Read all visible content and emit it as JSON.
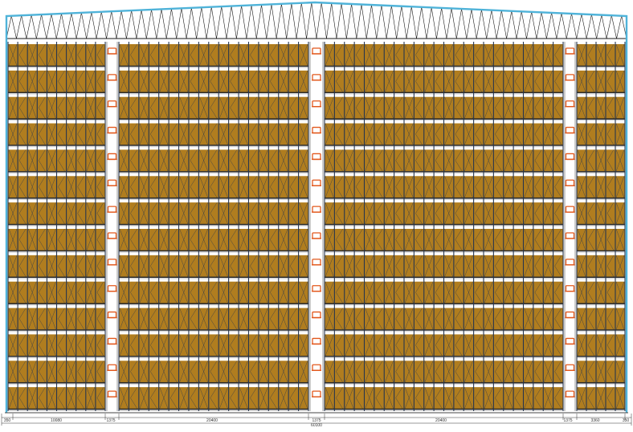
{
  "drawing": {
    "type": "warehouse-rack-elevation",
    "levels": 14,
    "aisles": 3,
    "colors": {
      "building_outline": "#4fb3d9",
      "truss": "#1a1a1a",
      "pallet_load": "#b07d1f",
      "pallet_load_dark": "#8a5f12",
      "rack_upright": "#27364f",
      "beam": "#2a2a2a",
      "stacker_crane": "#e2581c",
      "dimension_line": "#333333"
    },
    "dimensions": {
      "seg_left_edge": "350",
      "seg_block1": "10080",
      "seg_aisle1": "1375",
      "seg_block2": "20400",
      "seg_aisle2": "1375",
      "seg_block3": "20400",
      "seg_aisle3": "1375",
      "seg_block4": "3360",
      "seg_right_edge": "350",
      "total": "60100"
    }
  }
}
